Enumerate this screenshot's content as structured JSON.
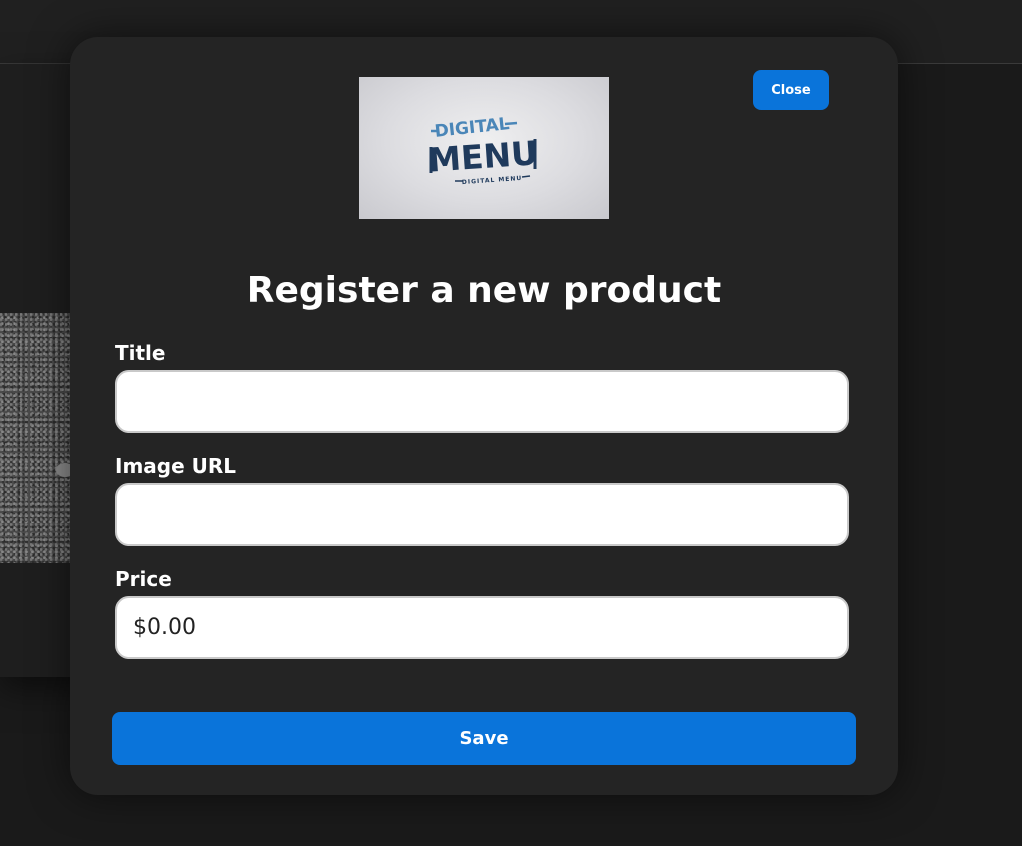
{
  "modal": {
    "close_label": "Close",
    "title": "Register a new product",
    "save_label": "Save"
  },
  "logo": {
    "line1": "DIGITAL",
    "line2": "MENU",
    "tagline": "DIGITAL MENU",
    "colors": {
      "primary": "#1f3a5c",
      "accent": "#4a86b8"
    }
  },
  "form": {
    "fields": [
      {
        "label": "Title",
        "value": "",
        "placeholder": ""
      },
      {
        "label": "Image URL",
        "value": "",
        "placeholder": ""
      },
      {
        "label": "Price",
        "value": "",
        "placeholder": "$0.00"
      }
    ]
  },
  "colors": {
    "page_background": "#1a1a1a",
    "modal_background": "#242424",
    "accent": "#0a74da",
    "text": "#ffffff"
  }
}
